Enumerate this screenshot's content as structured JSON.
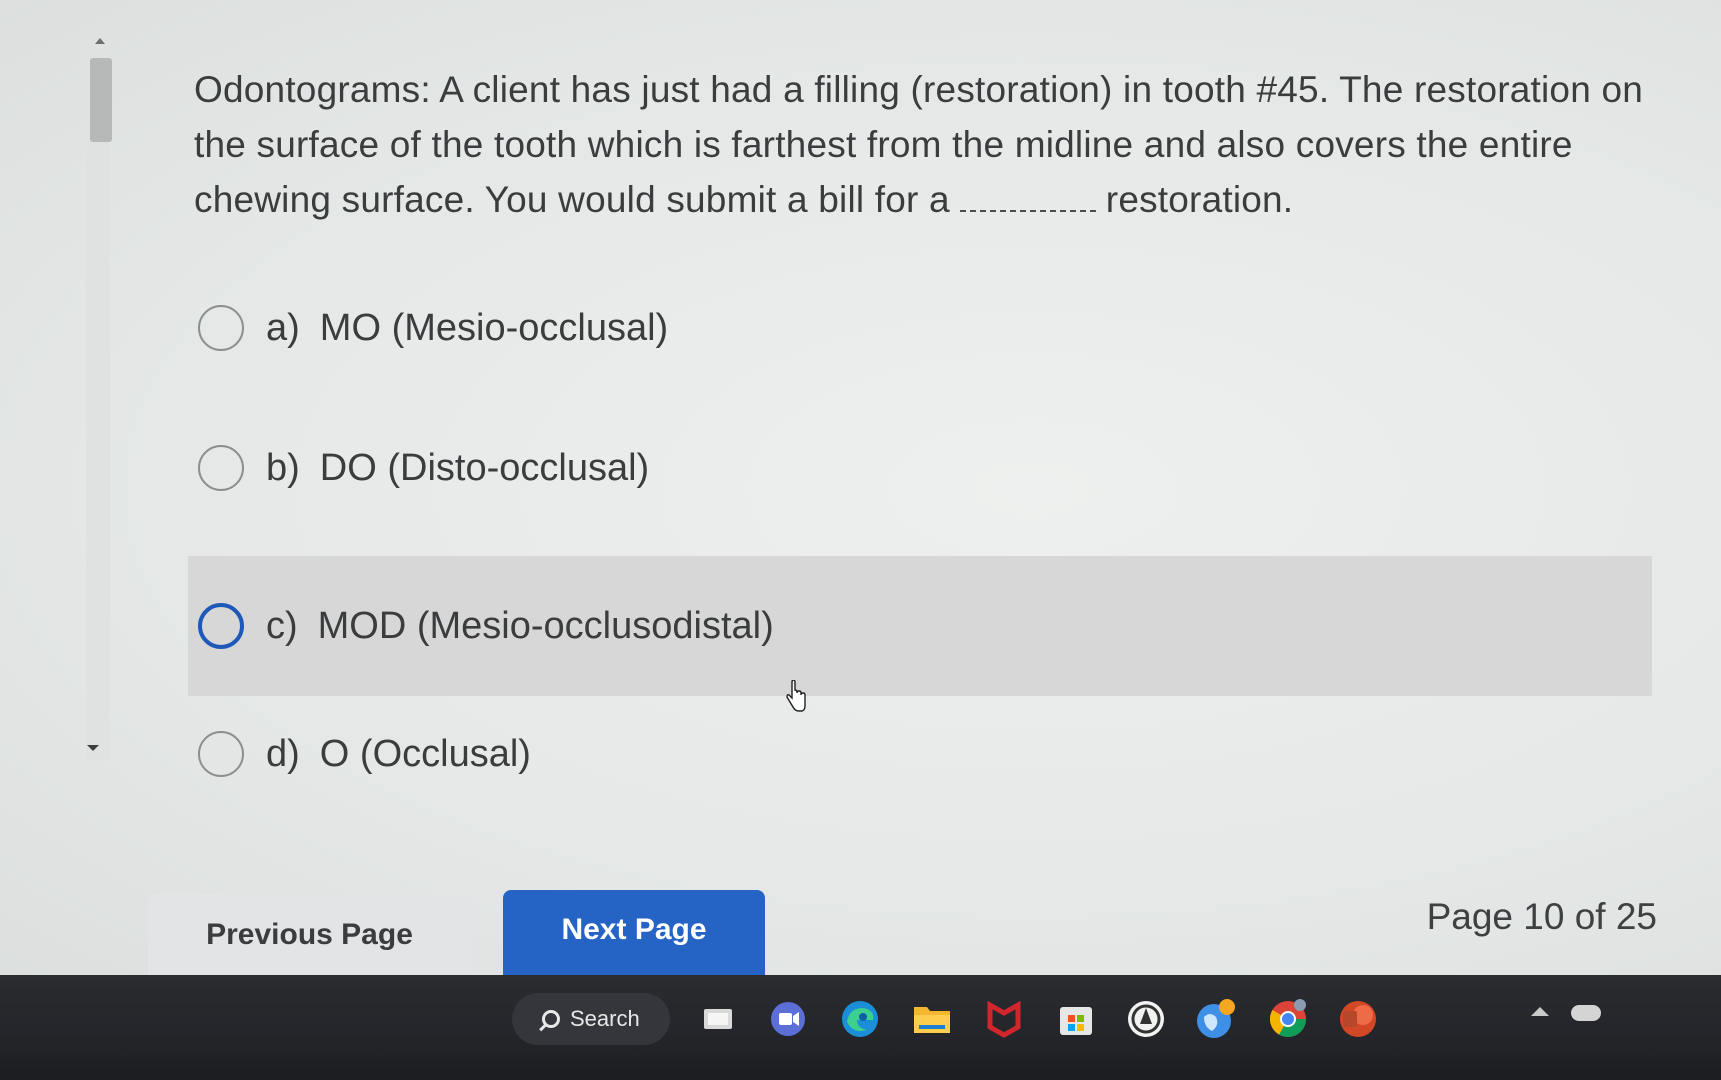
{
  "question": {
    "text_before_blank": "Odontograms: A client has just had a filling (restoration) in tooth #45. The restoration on the surface of the tooth which is farthest from the midline and also covers the entire chewing surface. You would submit a bill for a",
    "text_after_blank": "restoration."
  },
  "options": [
    {
      "letter": "a)",
      "text": "MO (Mesio-occlusal)",
      "selected": false
    },
    {
      "letter": "b)",
      "text": "DO (Disto-occlusal)",
      "selected": false
    },
    {
      "letter": "c)",
      "text": "MOD (Mesio-occlusodistal)",
      "selected": false,
      "hovered": true
    },
    {
      "letter": "d)",
      "text": "O (Occlusal)",
      "selected": false
    }
  ],
  "navigation": {
    "previous_label": "Previous Page",
    "next_label": "Next Page",
    "page_indicator": "Page 10 of 25"
  },
  "taskbar": {
    "search_label": "Search",
    "icons": [
      "windows-start-icon",
      "search-icon",
      "task-view-icon",
      "teams-meet-icon",
      "edge-icon",
      "file-explorer-icon",
      "mcafee-icon",
      "microsoft-store-icon",
      "app-circle-icon",
      "browser-globe-icon",
      "chrome-icon",
      "powerpoint-icon"
    ]
  },
  "colors": {
    "accent": "#2563c4",
    "selected_radio": "#1e58b8",
    "highlight_row": "#d6d7d6",
    "taskbar": "#23252a"
  }
}
